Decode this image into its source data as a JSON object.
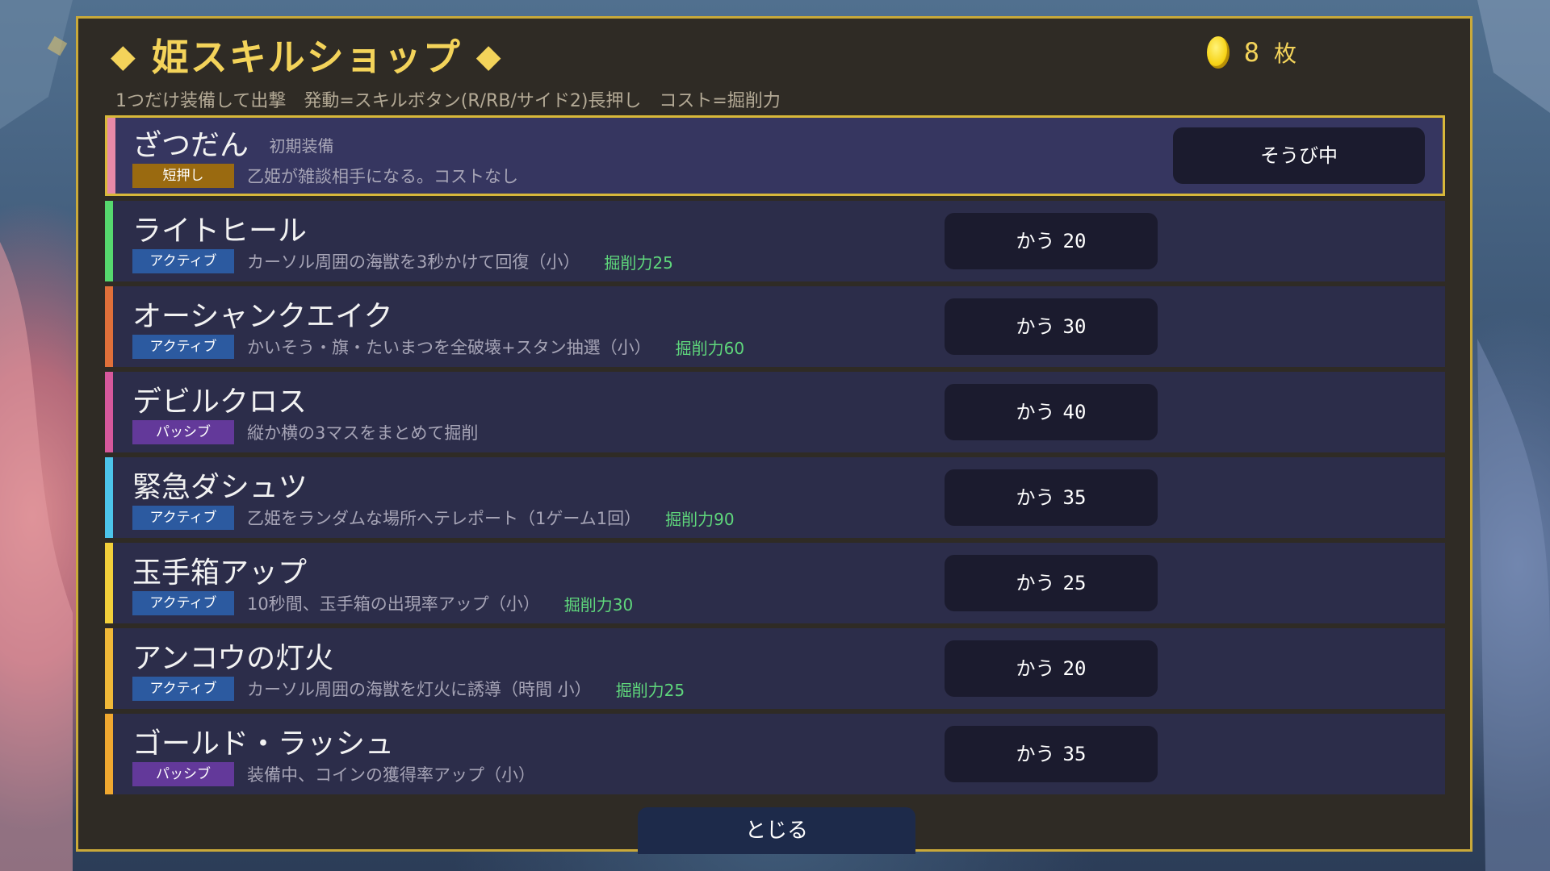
{
  "header": {
    "title": "姫スキルショップ",
    "diamond_left": "◆",
    "diamond_right": "◆",
    "coin_count": "8",
    "coin_unit": "枚",
    "subtitle": "1つだけ装備して出撃　発動=スキルボタン(R/RB/サイド2)長押し　コスト=掘削力"
  },
  "skills": [
    {
      "name": "ざつだん",
      "tag": "初期装備",
      "badge": "短押し",
      "description": "乙姫が雑談相手になる。コストなし",
      "cost": "",
      "button": "そうび中",
      "price": "",
      "stripe_color": "#e88aa8"
    },
    {
      "name": "ライトヒール",
      "badge": "アクティブ",
      "description": "カーソル周囲の海獣を3秒かけて回復（小）",
      "cost": "掘削力25",
      "button": "かう",
      "price": "20",
      "stripe_color": "#56d86e"
    },
    {
      "name": "オーシャンクエイク",
      "badge": "アクティブ",
      "description": "かいそう・旗・たいまつを全破壊+スタン抽選（小）",
      "cost": "掘削力60",
      "button": "かう",
      "price": "30",
      "stripe_color": "#e0703a"
    },
    {
      "name": "デビルクロス",
      "badge": "パッシブ",
      "description": "縦か横の3マスをまとめて掘削",
      "cost": "",
      "button": "かう",
      "price": "40",
      "stripe_color": "#d6589c"
    },
    {
      "name": "緊急ダシュツ",
      "badge": "アクティブ",
      "description": "乙姫をランダムな場所へテレポート（1ゲーム1回）",
      "cost": "掘削力90",
      "button": "かう",
      "price": "35",
      "stripe_color": "#4cc4ea"
    },
    {
      "name": "玉手箱アップ",
      "badge": "アクティブ",
      "description": "10秒間、玉手箱の出現率アップ（小）",
      "cost": "掘削力30",
      "button": "かう",
      "price": "25",
      "stripe_color": "#f2cf3a"
    },
    {
      "name": "アンコウの灯火",
      "badge": "アクティブ",
      "description": "カーソル周囲の海獣を灯火に誘導（時間 小）",
      "cost": "掘削力25",
      "button": "かう",
      "price": "20",
      "stripe_color": "#f0b838"
    },
    {
      "name": "ゴールド・ラッシュ",
      "badge": "パッシブ",
      "description": "装備中、コインの獲得率アップ（小）",
      "cost": "",
      "button": "かう",
      "price": "35",
      "stripe_color": "#f0a830"
    }
  ],
  "footer": {
    "close_label": "とじる"
  },
  "colors": {
    "panel_border": "#c9a93a",
    "title": "#f3d35a",
    "cost": "#5fd77c",
    "active_badge": "#2c5aa0",
    "passive_badge": "#63399a",
    "short_badge": "#9a6a10"
  }
}
